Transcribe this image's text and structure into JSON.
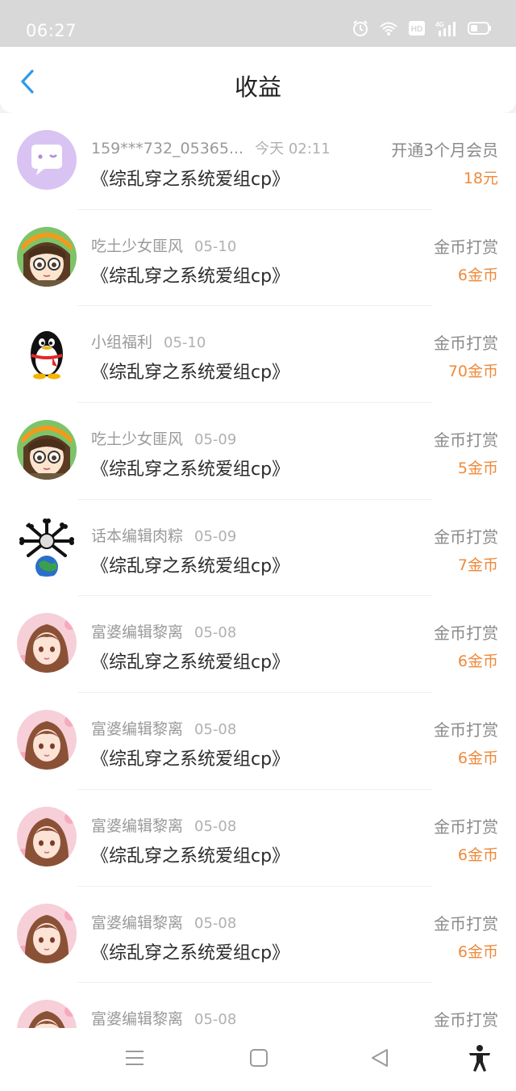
{
  "status_bar": {
    "time": "06:27",
    "icons": [
      "alarm-icon",
      "wifi-icon",
      "hd-icon",
      "signal-4g-icon",
      "battery-icon"
    ]
  },
  "header": {
    "title": "收益",
    "back_icon": "chevron-left-icon"
  },
  "colors": {
    "accent_blue": "#2f9be8",
    "amount_orange": "#ef8a3c"
  },
  "records": [
    {
      "user": "159***732_05365...",
      "date": "今天 02:11",
      "book": "《综乱穿之系统爱组cp》",
      "type": "开通3个月会员",
      "amount": "18元",
      "avatar": "chat-bubble-avatar"
    },
    {
      "user": "吃土少女匪风",
      "date": "05-10",
      "book": "《综乱穿之系统爱组cp》",
      "type": "金币打赏",
      "amount": "6金币",
      "avatar": "anime-girl-glasses-avatar"
    },
    {
      "user": "小组福利",
      "date": "05-10",
      "book": "《综乱穿之系统爱组cp》",
      "type": "金币打赏",
      "amount": "70金币",
      "avatar": "penguin-avatar"
    },
    {
      "user": "吃土少女匪风",
      "date": "05-09",
      "book": "《综乱穿之系统爱组cp》",
      "type": "金币打赏",
      "amount": "5金币",
      "avatar": "anime-girl-glasses-avatar"
    },
    {
      "user": "话本编辑肉粽",
      "date": "05-09",
      "book": "《综乱穿之系统爱组cp》",
      "type": "金币打赏",
      "amount": "7金币",
      "avatar": "earth-bones-avatar"
    },
    {
      "user": "富婆编辑黎离",
      "date": "05-08",
      "book": "《综乱穿之系统爱组cp》",
      "type": "金币打赏",
      "amount": "6金币",
      "avatar": "anime-girl-flowers-avatar"
    },
    {
      "user": "富婆编辑黎离",
      "date": "05-08",
      "book": "《综乱穿之系统爱组cp》",
      "type": "金币打赏",
      "amount": "6金币",
      "avatar": "anime-girl-flowers-avatar"
    },
    {
      "user": "富婆编辑黎离",
      "date": "05-08",
      "book": "《综乱穿之系统爱组cp》",
      "type": "金币打赏",
      "amount": "6金币",
      "avatar": "anime-girl-flowers-avatar"
    },
    {
      "user": "富婆编辑黎离",
      "date": "05-08",
      "book": "《综乱穿之系统爱组cp》",
      "type": "金币打赏",
      "amount": "6金币",
      "avatar": "anime-girl-flowers-avatar"
    },
    {
      "user": "富婆编辑黎离",
      "date": "05-08",
      "book": "",
      "type": "金币打赏",
      "amount": "",
      "avatar": "anime-girl-flowers-avatar"
    }
  ],
  "nav_bar": {
    "buttons": [
      "menu-icon",
      "home-square-icon",
      "back-triangle-icon",
      "accessibility-icon"
    ]
  }
}
